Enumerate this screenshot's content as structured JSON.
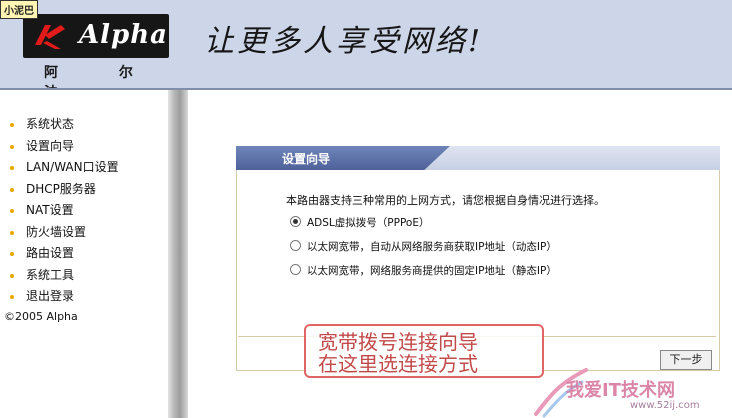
{
  "header": {
    "badge": "小泥巴",
    "logo_text": "Alpha",
    "brand_cn": "阿 尔 法",
    "tagline": "让更多人享受网络!"
  },
  "sidebar": {
    "items": [
      {
        "label": "系统状态"
      },
      {
        "label": "设置向导"
      },
      {
        "label": "LAN/WAN口设置"
      },
      {
        "label": "DHCP服务器"
      },
      {
        "label": "NAT设置"
      },
      {
        "label": "防火墙设置"
      },
      {
        "label": "路由设置"
      },
      {
        "label": "系统工具"
      },
      {
        "label": "退出登录"
      }
    ],
    "copyright": "©2005 Alpha"
  },
  "wizard": {
    "title": "设置向导",
    "intro": "本路由器支持三种常用的上网方式，请您根据自身情况进行选择。",
    "options": [
      {
        "label": "ADSL虚拟拨号（PPPoE）",
        "checked": true
      },
      {
        "label": "以太网宽带，自动从网络服务商获取IP地址（动态IP）",
        "checked": false
      },
      {
        "label": "以太网宽带，网络服务商提供的固定IP地址（静态IP）",
        "checked": false
      }
    ],
    "next_label": "下一步"
  },
  "annotation": {
    "line1": "宽带拨号连接向导",
    "line2": "在这里选连接方式"
  },
  "watermark": {
    "site": "我爱IT技术网",
    "url": "www.52ij.com"
  },
  "colors": {
    "header_bg": "#ccd6e8",
    "tab_blue": "#4e629a",
    "annotation_red": "#c34a4a",
    "bullet": "#e8a800"
  }
}
